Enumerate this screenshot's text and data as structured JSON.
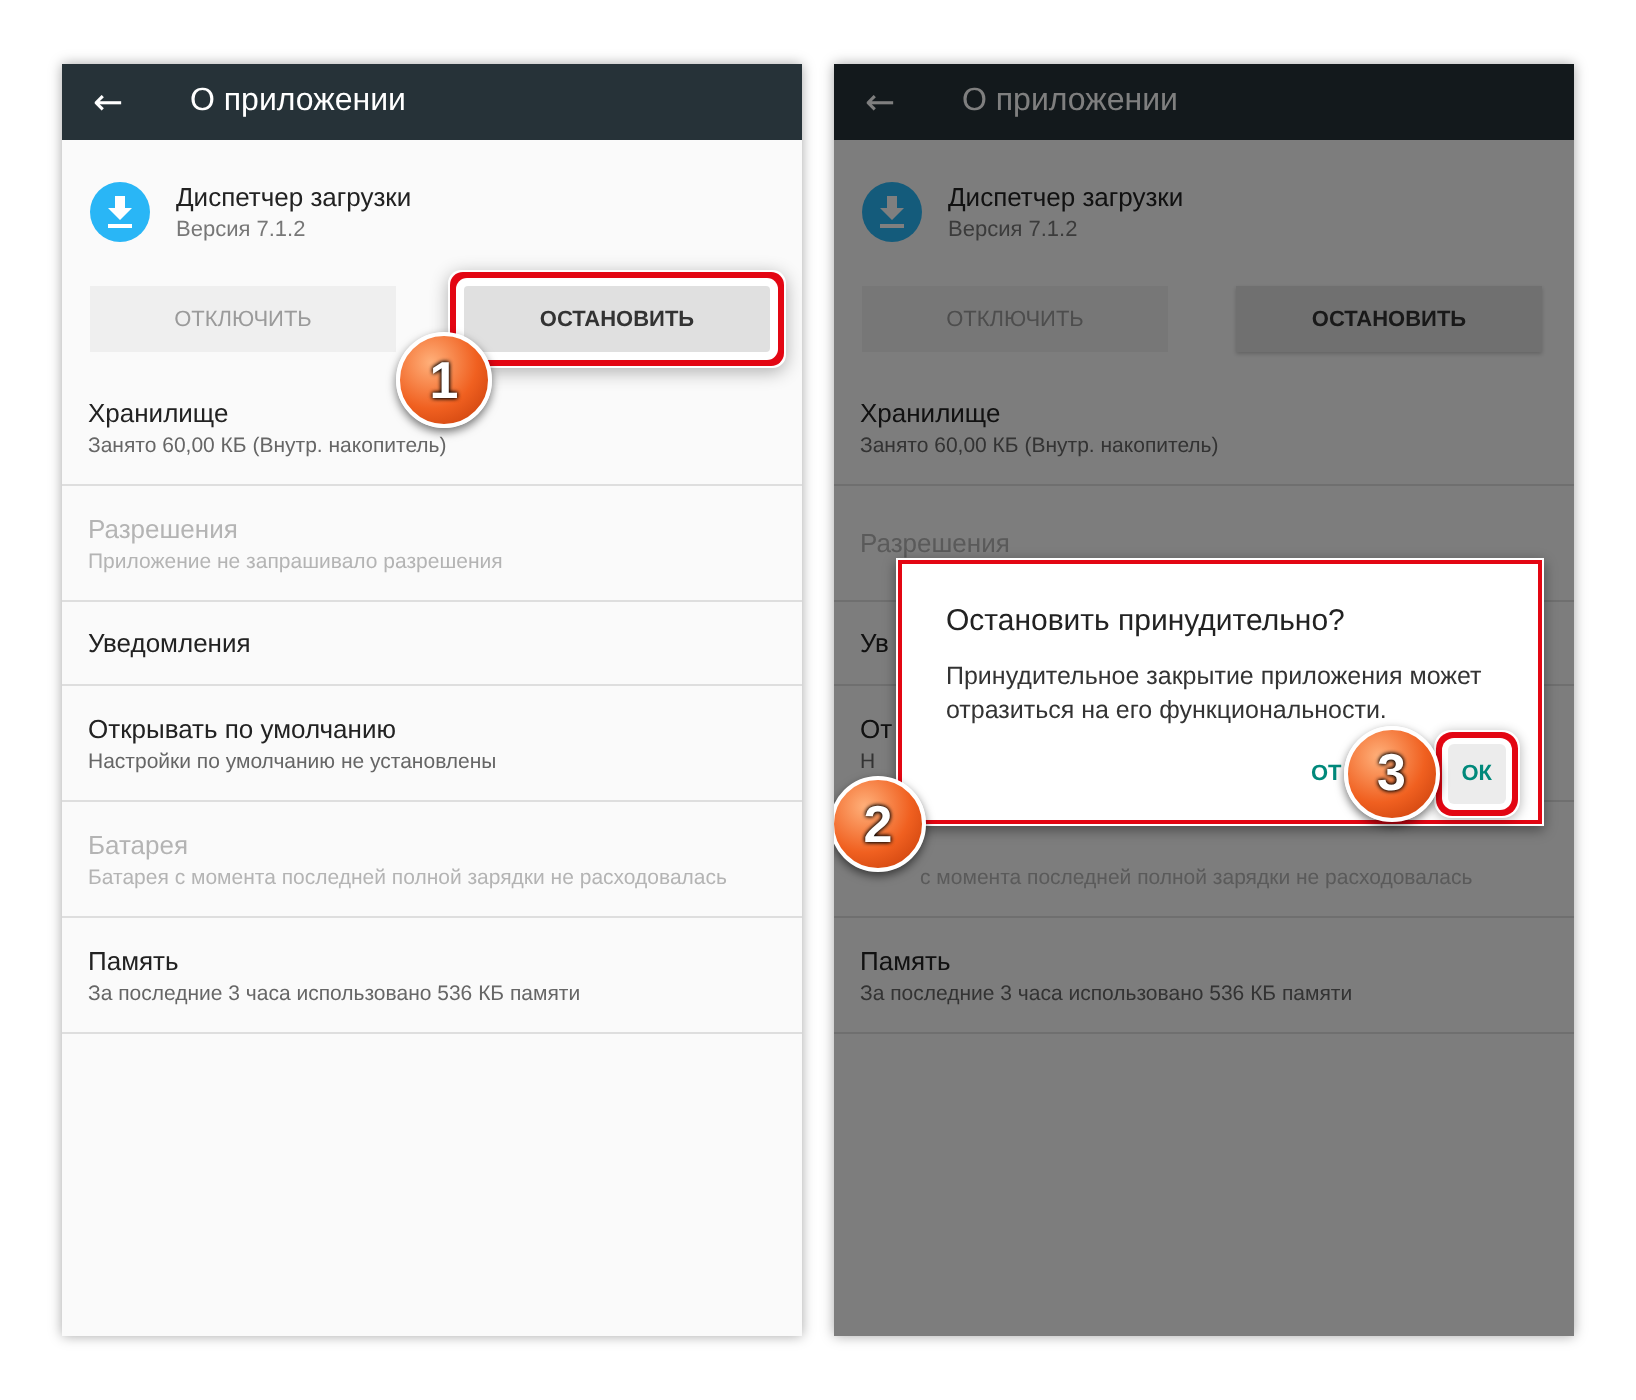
{
  "screens": [
    {
      "dimmed": false,
      "header": {
        "back": "←",
        "title": "О приложении"
      },
      "app": {
        "name": "Диспетчер загрузки",
        "version": "Версия 7.1.2"
      },
      "buttons": [
        {
          "label": "ОТКЛЮЧИТЬ",
          "disabled": true,
          "highlighted": false
        },
        {
          "label": "ОСТАНОВИТЬ",
          "disabled": false,
          "highlighted": true,
          "badge": "1"
        }
      ],
      "items": [
        {
          "kind": "double",
          "title": "Хранилище",
          "subtitle": "Занято 60,00 КБ (Внутр. накопитель)",
          "disabled": false
        },
        {
          "kind": "double",
          "title": "Разрешения",
          "subtitle": "Приложение не запрашивало разрешения",
          "disabled": true
        },
        {
          "kind": "single",
          "title": "Уведомления",
          "disabled": false
        },
        {
          "kind": "double",
          "title": "Открывать по умолчанию",
          "subtitle": "Настройки по умолчанию не установлены",
          "disabled": false
        },
        {
          "kind": "double",
          "title": "Батарея",
          "subtitle": "Батарея с момента последней полной зарядки не расходовалась",
          "disabled": true
        },
        {
          "kind": "double",
          "title": "Память",
          "subtitle": "За последние 3 часа использовано 536 КБ памяти",
          "disabled": false
        }
      ]
    },
    {
      "dimmed": true,
      "header": {
        "back": "←",
        "title": "О приложении"
      },
      "app": {
        "name": "Диспетчер загрузки",
        "version": "Версия 7.1.2"
      },
      "buttons": [
        {
          "label": "ОТКЛЮЧИТЬ",
          "disabled": true,
          "highlighted": false
        },
        {
          "label": "ОСТАНОВИТЬ",
          "disabled": false,
          "highlighted": false
        }
      ],
      "items": [
        {
          "kind": "double",
          "title": "Хранилище",
          "subtitle": "Занято 60,00 КБ (Внутр. накопитель)",
          "disabled": false
        },
        {
          "kind": "double",
          "title": "Разрешения",
          "disabled": true
        },
        {
          "kind": "single",
          "title": "Ув",
          "disabled": false
        },
        {
          "kind": "double",
          "title": "От",
          "subtitle": "Н",
          "disabled": false
        },
        {
          "kind": "double",
          "subtitle": "с момента последней полной зарядки не расходовалась",
          "disabled": true
        },
        {
          "kind": "double",
          "title": "Память",
          "subtitle": "За последние 3 часа использовано 536 КБ памяти",
          "disabled": false
        }
      ],
      "dialog": {
        "title": "Остановить принудительно?",
        "message": "Принудительное закрытие приложения может отразиться на его функциональности.",
        "highlighted": true,
        "badge": "2",
        "actions": [
          {
            "label": "ОТ",
            "highlighted": false
          },
          {
            "label": "ОК",
            "highlighted": true,
            "badge": "3"
          }
        ]
      }
    }
  ]
}
